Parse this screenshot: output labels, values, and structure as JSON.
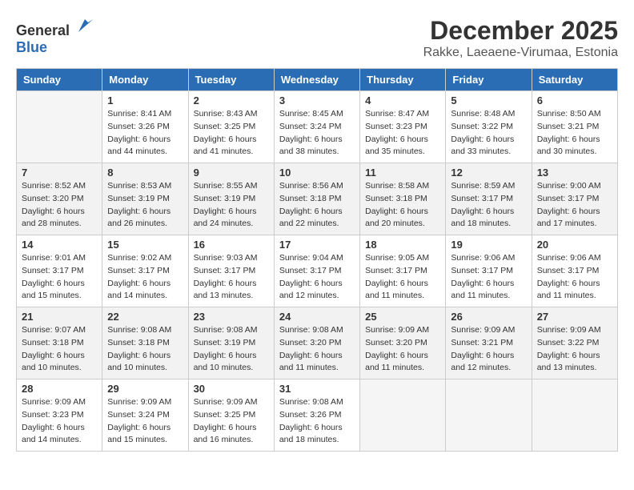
{
  "header": {
    "logo_general": "General",
    "logo_blue": "Blue",
    "month_year": "December 2025",
    "location": "Rakke, Laeaene-Virumaa, Estonia"
  },
  "weekdays": [
    "Sunday",
    "Monday",
    "Tuesday",
    "Wednesday",
    "Thursday",
    "Friday",
    "Saturday"
  ],
  "weeks": [
    [
      {
        "day": "",
        "sunrise": "",
        "sunset": "",
        "daylight": ""
      },
      {
        "day": "1",
        "sunrise": "8:41 AM",
        "sunset": "3:26 PM",
        "daylight": "6 hours and 44 minutes."
      },
      {
        "day": "2",
        "sunrise": "8:43 AM",
        "sunset": "3:25 PM",
        "daylight": "6 hours and 41 minutes."
      },
      {
        "day": "3",
        "sunrise": "8:45 AM",
        "sunset": "3:24 PM",
        "daylight": "6 hours and 38 minutes."
      },
      {
        "day": "4",
        "sunrise": "8:47 AM",
        "sunset": "3:23 PM",
        "daylight": "6 hours and 35 minutes."
      },
      {
        "day": "5",
        "sunrise": "8:48 AM",
        "sunset": "3:22 PM",
        "daylight": "6 hours and 33 minutes."
      },
      {
        "day": "6",
        "sunrise": "8:50 AM",
        "sunset": "3:21 PM",
        "daylight": "6 hours and 30 minutes."
      }
    ],
    [
      {
        "day": "7",
        "sunrise": "8:52 AM",
        "sunset": "3:20 PM",
        "daylight": "6 hours and 28 minutes."
      },
      {
        "day": "8",
        "sunrise": "8:53 AM",
        "sunset": "3:19 PM",
        "daylight": "6 hours and 26 minutes."
      },
      {
        "day": "9",
        "sunrise": "8:55 AM",
        "sunset": "3:19 PM",
        "daylight": "6 hours and 24 minutes."
      },
      {
        "day": "10",
        "sunrise": "8:56 AM",
        "sunset": "3:18 PM",
        "daylight": "6 hours and 22 minutes."
      },
      {
        "day": "11",
        "sunrise": "8:58 AM",
        "sunset": "3:18 PM",
        "daylight": "6 hours and 20 minutes."
      },
      {
        "day": "12",
        "sunrise": "8:59 AM",
        "sunset": "3:17 PM",
        "daylight": "6 hours and 18 minutes."
      },
      {
        "day": "13",
        "sunrise": "9:00 AM",
        "sunset": "3:17 PM",
        "daylight": "6 hours and 17 minutes."
      }
    ],
    [
      {
        "day": "14",
        "sunrise": "9:01 AM",
        "sunset": "3:17 PM",
        "daylight": "6 hours and 15 minutes."
      },
      {
        "day": "15",
        "sunrise": "9:02 AM",
        "sunset": "3:17 PM",
        "daylight": "6 hours and 14 minutes."
      },
      {
        "day": "16",
        "sunrise": "9:03 AM",
        "sunset": "3:17 PM",
        "daylight": "6 hours and 13 minutes."
      },
      {
        "day": "17",
        "sunrise": "9:04 AM",
        "sunset": "3:17 PM",
        "daylight": "6 hours and 12 minutes."
      },
      {
        "day": "18",
        "sunrise": "9:05 AM",
        "sunset": "3:17 PM",
        "daylight": "6 hours and 11 minutes."
      },
      {
        "day": "19",
        "sunrise": "9:06 AM",
        "sunset": "3:17 PM",
        "daylight": "6 hours and 11 minutes."
      },
      {
        "day": "20",
        "sunrise": "9:06 AM",
        "sunset": "3:17 PM",
        "daylight": "6 hours and 11 minutes."
      }
    ],
    [
      {
        "day": "21",
        "sunrise": "9:07 AM",
        "sunset": "3:18 PM",
        "daylight": "6 hours and 10 minutes."
      },
      {
        "day": "22",
        "sunrise": "9:08 AM",
        "sunset": "3:18 PM",
        "daylight": "6 hours and 10 minutes."
      },
      {
        "day": "23",
        "sunrise": "9:08 AM",
        "sunset": "3:19 PM",
        "daylight": "6 hours and 10 minutes."
      },
      {
        "day": "24",
        "sunrise": "9:08 AM",
        "sunset": "3:20 PM",
        "daylight": "6 hours and 11 minutes."
      },
      {
        "day": "25",
        "sunrise": "9:09 AM",
        "sunset": "3:20 PM",
        "daylight": "6 hours and 11 minutes."
      },
      {
        "day": "26",
        "sunrise": "9:09 AM",
        "sunset": "3:21 PM",
        "daylight": "6 hours and 12 minutes."
      },
      {
        "day": "27",
        "sunrise": "9:09 AM",
        "sunset": "3:22 PM",
        "daylight": "6 hours and 13 minutes."
      }
    ],
    [
      {
        "day": "28",
        "sunrise": "9:09 AM",
        "sunset": "3:23 PM",
        "daylight": "6 hours and 14 minutes."
      },
      {
        "day": "29",
        "sunrise": "9:09 AM",
        "sunset": "3:24 PM",
        "daylight": "6 hours and 15 minutes."
      },
      {
        "day": "30",
        "sunrise": "9:09 AM",
        "sunset": "3:25 PM",
        "daylight": "6 hours and 16 minutes."
      },
      {
        "day": "31",
        "sunrise": "9:08 AM",
        "sunset": "3:26 PM",
        "daylight": "6 hours and 18 minutes."
      },
      {
        "day": "",
        "sunrise": "",
        "sunset": "",
        "daylight": ""
      },
      {
        "day": "",
        "sunrise": "",
        "sunset": "",
        "daylight": ""
      },
      {
        "day": "",
        "sunrise": "",
        "sunset": "",
        "daylight": ""
      }
    ]
  ]
}
